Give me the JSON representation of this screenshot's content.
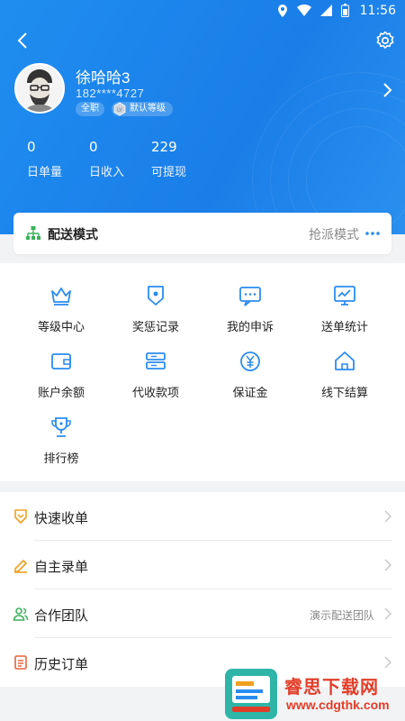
{
  "statusbar": {
    "time": "11:56"
  },
  "profile": {
    "name": "徐哈哈3",
    "phone": "182****4727",
    "role_badge": "全职",
    "level_badge": "默认等级"
  },
  "stats": [
    {
      "value": "0",
      "label": "日单量"
    },
    {
      "value": "0",
      "label": "日收入"
    },
    {
      "value": "229",
      "label": "可提现"
    }
  ],
  "delivery_mode": {
    "title": "配送模式",
    "value": "抢派模式"
  },
  "grid_items": [
    {
      "label": "等级中心",
      "icon": "crown-icon"
    },
    {
      "label": "奖惩记录",
      "icon": "reward-shield-icon"
    },
    {
      "label": "我的申诉",
      "icon": "chat-bubble-icon"
    },
    {
      "label": "送单统计",
      "icon": "chart-board-icon"
    },
    {
      "label": "账户余额",
      "icon": "wallet-icon"
    },
    {
      "label": "代收款项",
      "icon": "cash-stack-icon"
    },
    {
      "label": "保证金",
      "icon": "yen-coin-icon"
    },
    {
      "label": "线下结算",
      "icon": "home-icon"
    },
    {
      "label": "排行榜",
      "icon": "trophy-icon"
    }
  ],
  "list_items": [
    {
      "label": "快速收单",
      "value": "",
      "icon": "quick-order-icon"
    },
    {
      "label": "自主录单",
      "value": "",
      "icon": "pen-icon"
    },
    {
      "label": "合作团队",
      "value": "演示配送团队",
      "icon": "team-icon"
    },
    {
      "label": "历史订单",
      "value": "",
      "icon": "history-doc-icon"
    }
  ],
  "watermark": {
    "text": "睿思下载网",
    "url": "www.cdgthk.com"
  },
  "colors": {
    "primary": "#1a84ee",
    "icon_blue": "#2a8cf0",
    "orange": "#f0a020",
    "green": "#3bb15a",
    "red": "#e23d28"
  }
}
